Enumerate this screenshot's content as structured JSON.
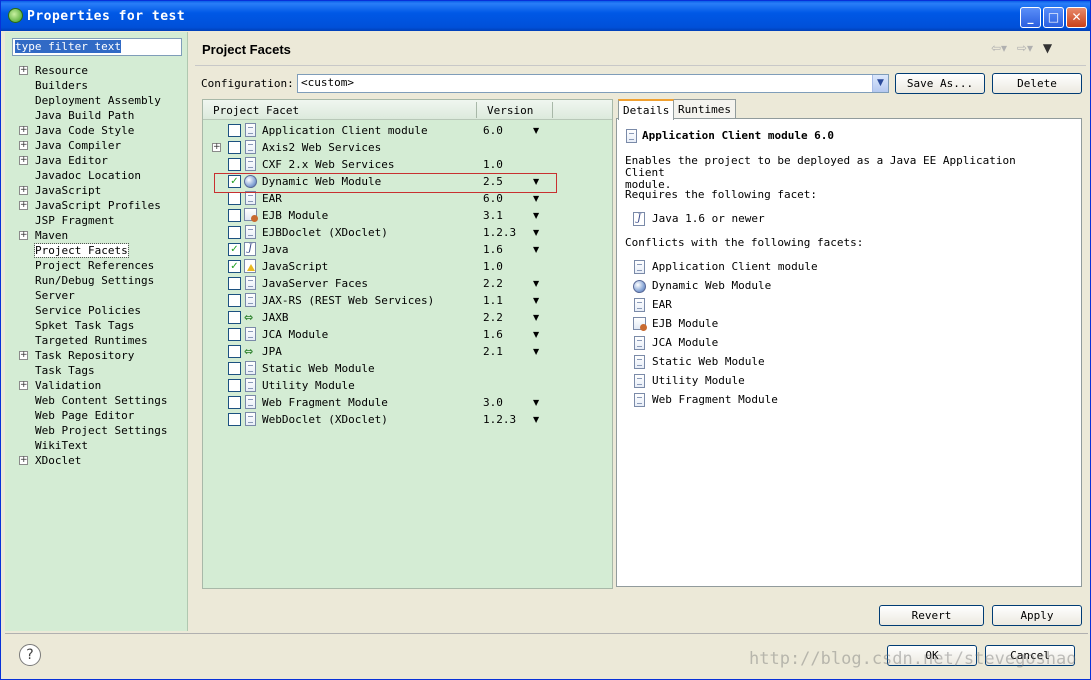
{
  "window": {
    "title": "Properties for test"
  },
  "filter": {
    "text": "type filter text"
  },
  "nav": [
    {
      "label": "Resource",
      "expandable": true
    },
    {
      "label": "Builders",
      "expandable": false
    },
    {
      "label": "Deployment Assembly",
      "expandable": false
    },
    {
      "label": "Java Build Path",
      "expandable": false
    },
    {
      "label": "Java Code Style",
      "expandable": true
    },
    {
      "label": "Java Compiler",
      "expandable": true
    },
    {
      "label": "Java Editor",
      "expandable": true
    },
    {
      "label": "Javadoc Location",
      "expandable": false
    },
    {
      "label": "JavaScript",
      "expandable": true
    },
    {
      "label": "JavaScript Profiles",
      "expandable": true
    },
    {
      "label": "JSP Fragment",
      "expandable": false
    },
    {
      "label": "Maven",
      "expandable": true
    },
    {
      "label": "Project Facets",
      "expandable": false,
      "selected": true
    },
    {
      "label": "Project References",
      "expandable": false
    },
    {
      "label": "Run/Debug Settings",
      "expandable": false
    },
    {
      "label": "Server",
      "expandable": false
    },
    {
      "label": "Service Policies",
      "expandable": false
    },
    {
      "label": "Spket Task Tags",
      "expandable": false
    },
    {
      "label": "Targeted Runtimes",
      "expandable": false
    },
    {
      "label": "Task Repository",
      "expandable": true
    },
    {
      "label": "Task Tags",
      "expandable": false
    },
    {
      "label": "Validation",
      "expandable": true
    },
    {
      "label": "Web Content Settings",
      "expandable": false
    },
    {
      "label": "Web Page Editor",
      "expandable": false
    },
    {
      "label": "Web Project Settings",
      "expandable": false
    },
    {
      "label": "WikiText",
      "expandable": false
    },
    {
      "label": "XDoclet",
      "expandable": true
    }
  ],
  "page": {
    "title": "Project Facets"
  },
  "config": {
    "label": "Configuration:",
    "value": "<custom>",
    "save_as": "Save As...",
    "delete": "Delete"
  },
  "facets": {
    "col_facet": "Project Facet",
    "col_version": "Version",
    "rows": [
      {
        "name": "Application Client module",
        "version": "6.0",
        "checked": false,
        "icon": "doc",
        "dropdown": true,
        "expandable": false
      },
      {
        "name": "Axis2 Web Services",
        "version": "",
        "checked": false,
        "icon": "doc",
        "dropdown": false,
        "expandable": true
      },
      {
        "name": "CXF 2.x Web Services",
        "version": "1.0",
        "checked": false,
        "icon": "doc",
        "dropdown": false,
        "expandable": false
      },
      {
        "name": "Dynamic Web Module",
        "version": "2.5",
        "checked": true,
        "icon": "globe",
        "dropdown": true,
        "expandable": false
      },
      {
        "name": "EAR",
        "version": "6.0",
        "checked": false,
        "icon": "doc",
        "dropdown": true,
        "expandable": false
      },
      {
        "name": "EJB Module",
        "version": "3.1",
        "checked": false,
        "icon": "bean",
        "dropdown": true,
        "expandable": false
      },
      {
        "name": "EJBDoclet (XDoclet)",
        "version": "1.2.3",
        "checked": false,
        "icon": "doc",
        "dropdown": true,
        "expandable": false
      },
      {
        "name": "Java",
        "version": "1.6",
        "checked": true,
        "icon": "jar",
        "dropdown": true,
        "expandable": false
      },
      {
        "name": "JavaScript",
        "version": "1.0",
        "checked": true,
        "icon": "js",
        "dropdown": false,
        "expandable": false
      },
      {
        "name": "JavaServer Faces",
        "version": "2.2",
        "checked": false,
        "icon": "doc",
        "dropdown": true,
        "expandable": false
      },
      {
        "name": "JAX-RS (REST Web Services)",
        "version": "1.1",
        "checked": false,
        "icon": "doc",
        "dropdown": true,
        "expandable": false
      },
      {
        "name": "JAXB",
        "version": "2.2",
        "checked": false,
        "icon": "arrows",
        "dropdown": true,
        "expandable": false
      },
      {
        "name": "JCA Module",
        "version": "1.6",
        "checked": false,
        "icon": "doc",
        "dropdown": true,
        "expandable": false
      },
      {
        "name": "JPA",
        "version": "2.1",
        "checked": false,
        "icon": "arrows",
        "dropdown": true,
        "expandable": false
      },
      {
        "name": "Static Web Module",
        "version": "",
        "checked": false,
        "icon": "doc",
        "dropdown": false,
        "expandable": false
      },
      {
        "name": "Utility Module",
        "version": "",
        "checked": false,
        "icon": "doc",
        "dropdown": false,
        "expandable": false
      },
      {
        "name": "Web Fragment Module",
        "version": "3.0",
        "checked": false,
        "icon": "doc",
        "dropdown": true,
        "expandable": false
      },
      {
        "name": "WebDoclet (XDoclet)",
        "version": "1.2.3",
        "checked": false,
        "icon": "doc",
        "dropdown": true,
        "expandable": false
      }
    ]
  },
  "details": {
    "tab_details": "Details",
    "tab_runtimes": "Runtimes",
    "title": "Application Client module 6.0",
    "desc_line1": "Enables the project to be deployed as a Java EE Application Client",
    "desc_line2": "module.",
    "requires_label": "Requires the following facet:",
    "requires": [
      {
        "name": "Java 1.6 or newer",
        "icon": "jar"
      }
    ],
    "conflicts_label": "Conflicts with the following facets:",
    "conflicts": [
      {
        "name": "Application Client module",
        "icon": "doc"
      },
      {
        "name": "Dynamic Web Module",
        "icon": "globe"
      },
      {
        "name": "EAR",
        "icon": "doc"
      },
      {
        "name": "EJB Module",
        "icon": "bean"
      },
      {
        "name": "JCA Module",
        "icon": "doc"
      },
      {
        "name": "Static Web Module",
        "icon": "doc"
      },
      {
        "name": "Utility Module",
        "icon": "doc"
      },
      {
        "name": "Web Fragment Module",
        "icon": "doc"
      }
    ]
  },
  "buttons": {
    "revert": "Revert",
    "apply": "Apply",
    "ok": "OK",
    "cancel": "Cancel"
  },
  "watermark": "http://blog.csdn.net/stevegoshao"
}
